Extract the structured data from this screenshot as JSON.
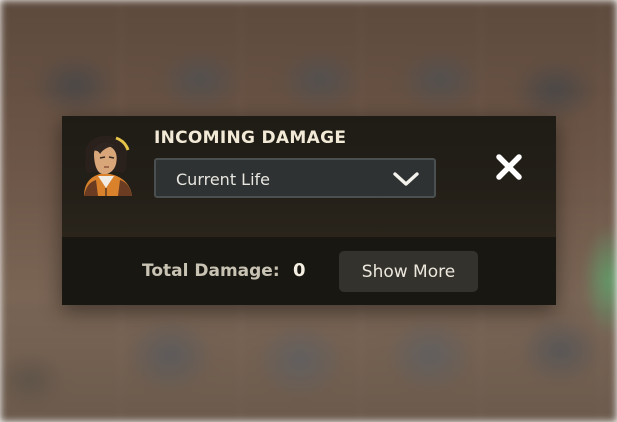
{
  "panel": {
    "title": "INCOMING DAMAGE",
    "portrait": "character-portrait",
    "dropdown": {
      "selected": "Current Life",
      "icon": "chevron-down-icon"
    },
    "close_icon": "close-icon"
  },
  "footer": {
    "total_label": "Total Damage:",
    "total_value": "0",
    "show_more_label": "Show More"
  },
  "colors": {
    "panel_bg": "#1c1a14",
    "footer_bg": "#181711",
    "title": "#f2ead6",
    "dropdown_bg": "#2e3232",
    "button_bg": "#34322d",
    "portrait_accent": "#d9822b"
  }
}
